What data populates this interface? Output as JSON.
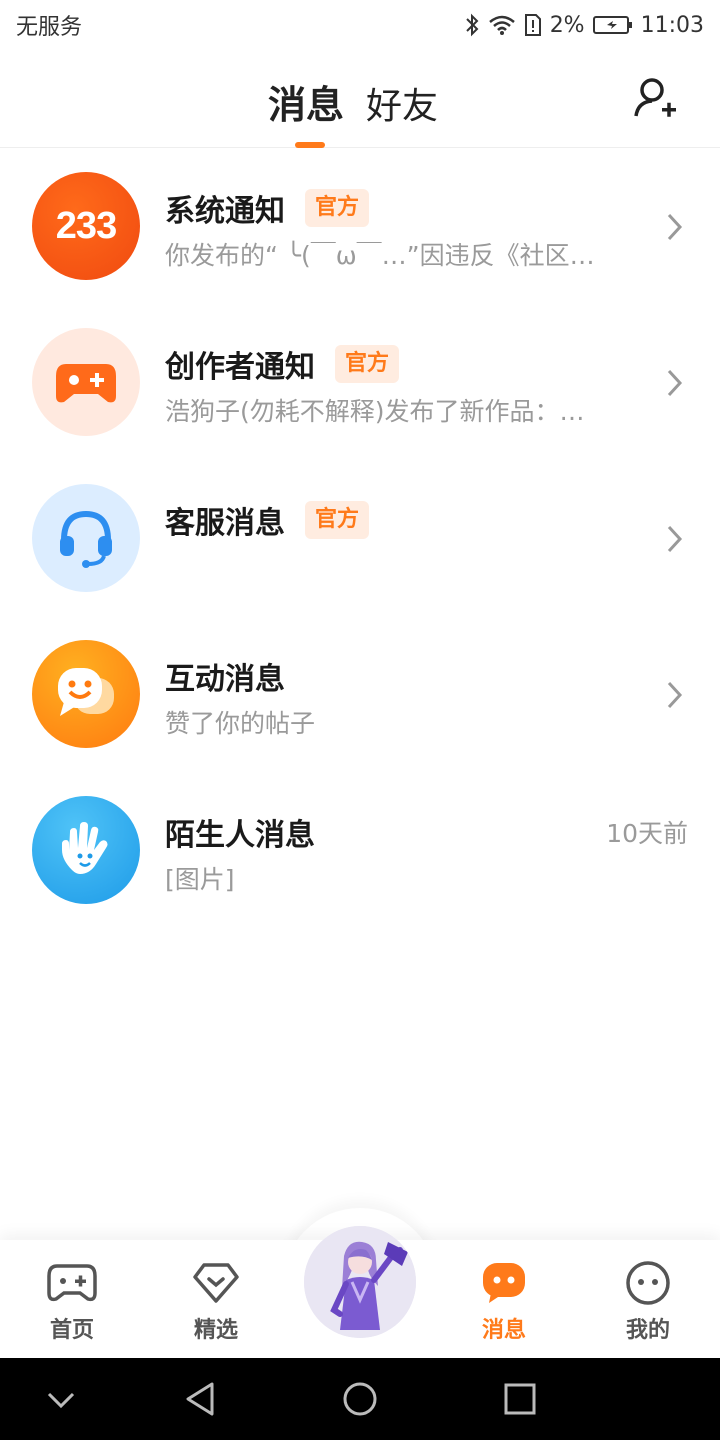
{
  "status_bar": {
    "carrier": "无服务",
    "battery": "2%",
    "time": "11:03"
  },
  "header": {
    "tabs": [
      {
        "label": "消息",
        "active": true
      },
      {
        "label": "好友",
        "active": false
      }
    ],
    "add_friend_icon": "add-user-icon"
  },
  "messages": [
    {
      "title": "系统通知",
      "badge": "官方",
      "subtitle": "你发布的“ ╰(￣ω￣…”因违反《社区…",
      "avatar_text": "233",
      "icon": "brand-233-icon"
    },
    {
      "title": "创作者通知",
      "badge": "官方",
      "subtitle": "浩狗子(勿耗不解释)发布了新作品：…",
      "icon": "gamepad-icon"
    },
    {
      "title": "客服消息",
      "badge": "官方",
      "subtitle": "",
      "icon": "headset-icon"
    },
    {
      "title": "互动消息",
      "subtitle": "赞了你的帖子",
      "icon": "chat-bubble-icon"
    },
    {
      "title": "陌生人消息",
      "subtitle": "[图片]",
      "time": "10天前",
      "icon": "hand-icon"
    }
  ],
  "bottom_nav": [
    {
      "label": "首页",
      "icon": "gamepad-icon",
      "active": false
    },
    {
      "label": "精选",
      "icon": "heart-icon",
      "active": false
    },
    {
      "label": "消息",
      "icon": "message-icon",
      "active": true
    },
    {
      "label": "我的",
      "icon": "face-icon",
      "active": false
    }
  ],
  "colors": {
    "accent": "#ff7a1a",
    "badge_bg": "#ffece0",
    "secondary_text": "#9a9a9a"
  }
}
